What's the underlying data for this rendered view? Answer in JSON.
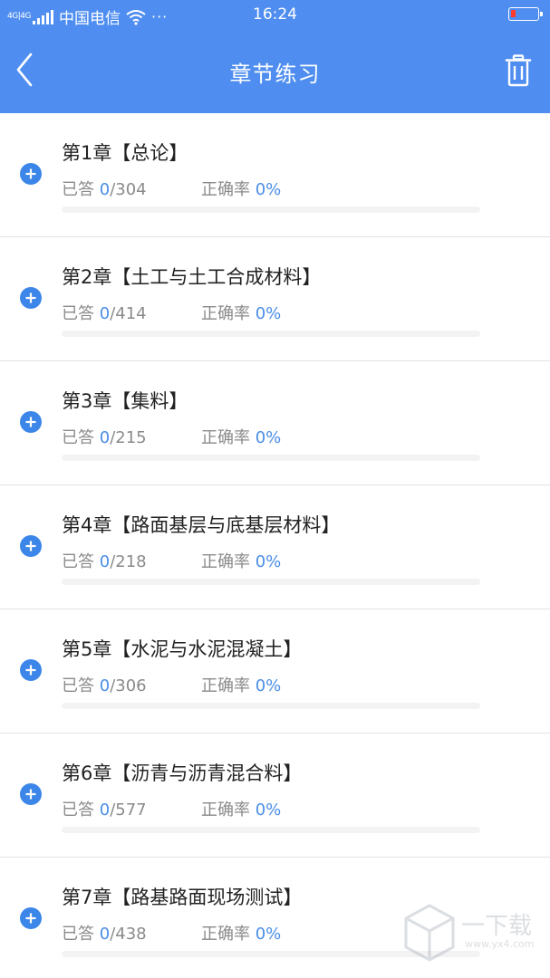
{
  "status_bar": {
    "network": "4G|4G",
    "carrier": "中国电信",
    "dots": "···",
    "time": "16:24",
    "battery_color": "#ff3b30"
  },
  "header": {
    "title": "章节练习",
    "back_icon": "chevron-left-icon",
    "trash_icon": "trash-icon",
    "bg_color": "#4f8ef0"
  },
  "labels": {
    "answered": "已答",
    "accuracy": "正确率",
    "slash": "/"
  },
  "chapters": [
    {
      "title": "第1章【总论】",
      "answered": "0",
      "total": "304",
      "accuracy": "0%",
      "progress": 0
    },
    {
      "title": "第2章【土工与土工合成材料】",
      "answered": "0",
      "total": "414",
      "accuracy": "0%",
      "progress": 0
    },
    {
      "title": "第3章【集料】",
      "answered": "0",
      "total": "215",
      "accuracy": "0%",
      "progress": 0
    },
    {
      "title": "第4章【路面基层与底基层材料】",
      "answered": "0",
      "total": "218",
      "accuracy": "0%",
      "progress": 0
    },
    {
      "title": "第5章【水泥与水泥混凝土】",
      "answered": "0",
      "total": "306",
      "accuracy": "0%",
      "progress": 0
    },
    {
      "title": "第6章【沥青与沥青混合料】",
      "answered": "0",
      "total": "577",
      "accuracy": "0%",
      "progress": 0
    },
    {
      "title": "第7章【路基路面现场测试】",
      "answered": "0",
      "total": "438",
      "accuracy": "0%",
      "progress": 0
    }
  ],
  "watermark": {
    "text": "一下载",
    "url": "www.yx4.com"
  },
  "colors": {
    "accent": "#4a8ee8",
    "add_icon": "#3b86e8"
  }
}
